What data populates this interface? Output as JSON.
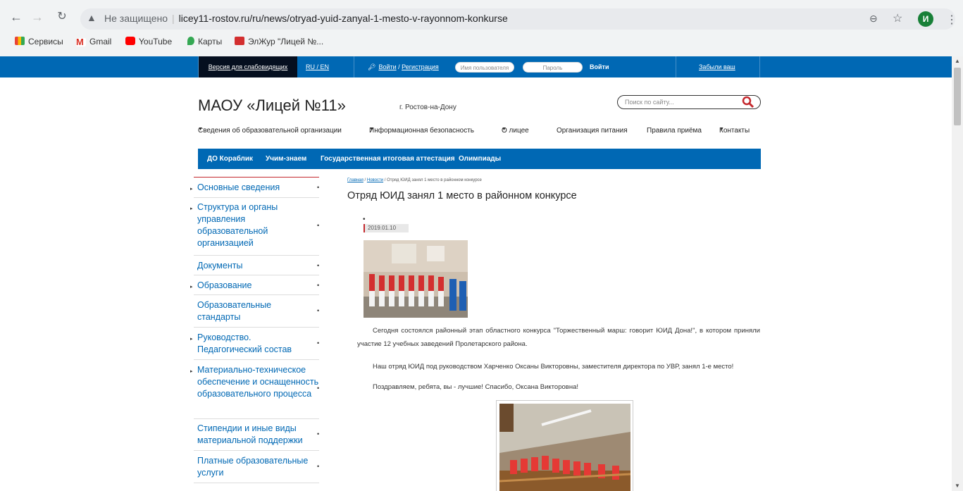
{
  "browser": {
    "omnibox_warning": "Не защищено",
    "url": "licey11-rostov.ru/ru/news/otryad-yuid-zanyal-1-mesto-v-rayonnom-konkurse",
    "avatar_letter": "И",
    "bookmarks": [
      {
        "label": "Сервисы",
        "icon": "apps-grid-icon",
        "color": "#ea4335"
      },
      {
        "label": "Gmail",
        "icon": "gmail-icon",
        "color": "#d93025"
      },
      {
        "label": "YouTube",
        "icon": "youtube-icon",
        "color": "#ff0000"
      },
      {
        "label": "Карты",
        "icon": "maps-pin-icon",
        "color": "#34a853"
      },
      {
        "label": "ЭлЖур \"Лицей №...",
        "icon": "eljur-icon",
        "color": "#d32f2f"
      }
    ]
  },
  "topbar": {
    "access_label": "Версия для слабовидящих",
    "lang_label": "RU / EN",
    "login_label": "Войти",
    "login_sep": " / ",
    "register_label": "Регистрация",
    "username_placeholder": "Имя пользователя",
    "password_placeholder": "Пароль",
    "enter_label": "Войти",
    "forgot_label": "Забыли ваш пароль?"
  },
  "header": {
    "title": "МАОУ «Лицей №11»",
    "city": "г. Ростов-на-Дону",
    "search_placeholder": "Поиск по сайту..."
  },
  "mainnav": [
    {
      "label": "Сведения об образовательной организации",
      "dropdown": true
    },
    {
      "label": "Информационная безопасность",
      "dropdown": true
    },
    {
      "label": "О лицее",
      "dropdown": true
    },
    {
      "label": "Организация питания",
      "dropdown": false
    },
    {
      "label": "Правила приёма",
      "dropdown": false
    },
    {
      "label": "Контакты",
      "dropdown": true
    }
  ],
  "subnav": [
    "ДО Кораблик",
    "Учим-знаем",
    "Государственная итоговая аттестация",
    "Олимпиады"
  ],
  "sidebar": [
    {
      "label": "Основные сведения",
      "arrow": true
    },
    {
      "label": "Структура и органы управления образовательной организацией",
      "arrow": true
    },
    {
      "label": "Документы",
      "arrow": false
    },
    {
      "label": "Образование",
      "arrow": true
    },
    {
      "label": "Образовательные стандарты",
      "arrow": false
    },
    {
      "label": "Руководство. Педагогический состав",
      "arrow": true
    },
    {
      "label": "Материально-техническое обеспечение и оснащенность образовательного процесса",
      "arrow": true
    },
    {
      "label": "Стипендии и иные виды материальной поддержки",
      "arrow": false
    },
    {
      "label": "Платные образовательные услуги",
      "arrow": false
    }
  ],
  "breadcrumb": {
    "home": "Главная",
    "news": "Новости",
    "current": "Отряд ЮИД занял 1 место в районном конкурсе",
    "sep": " / "
  },
  "article": {
    "title": "Отряд ЮИД занял 1 место в районном конкурсе",
    "date": "2019.01.10",
    "p1": "Сегодня состоялся районный этап областного конкурса \"Торжественный марш: говорит ЮИД Дона!\", в котором приняли участие 12 учебных заведений Пролетарского района.",
    "p2": "Наш отряд ЮИД под руководством Харченко Оксаны Викторовны, заместителя директора по УВР, занял 1-е место!",
    "p3": "Поздравляем, ребята, вы - лучшие! Спасибо, Оксана Викторовна!"
  }
}
